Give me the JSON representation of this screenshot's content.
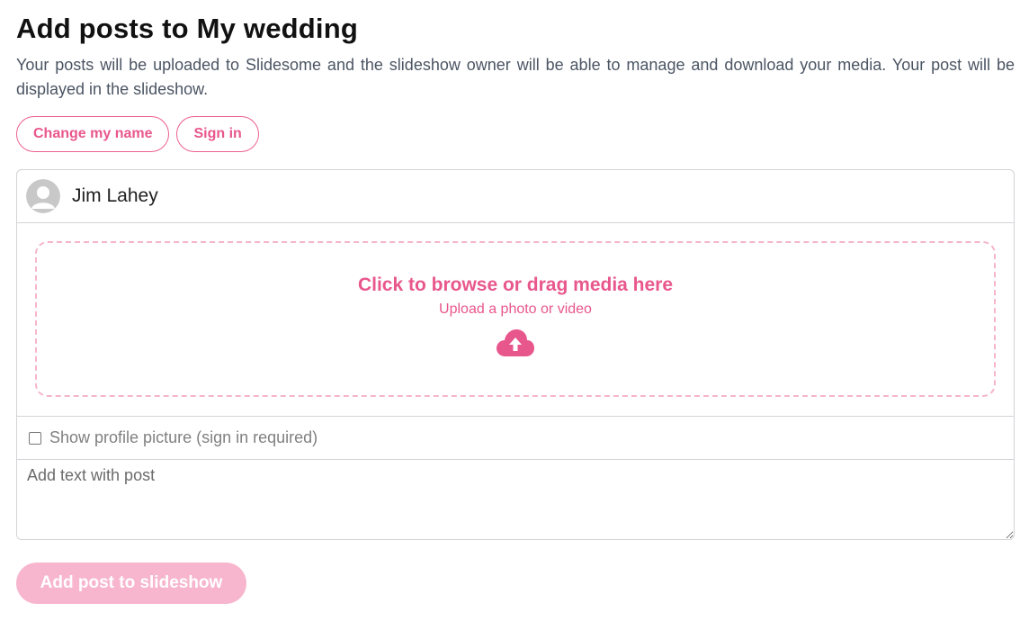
{
  "page": {
    "title": "Add posts to My wedding",
    "intro": "Your posts will be uploaded to Slidesome and the slideshow owner will be able to manage and download your media. Your post will be displayed in the slideshow."
  },
  "actions": {
    "change_name_label": "Change my name",
    "sign_in_label": "Sign in"
  },
  "post_form": {
    "user_name": "Jim Lahey",
    "avatar_icon": "default-user-avatar",
    "upload": {
      "title": "Click to browse or drag media here",
      "subtitle": "Upload a photo or video",
      "icon": "cloud-upload-icon"
    },
    "show_profile_picture": {
      "label": "Show profile picture (sign in required)",
      "checked": false
    },
    "text": {
      "placeholder": "Add text with post",
      "value": ""
    },
    "submit_label": "Add post to slideshow",
    "submit_enabled": false
  },
  "colors": {
    "accent": "#e8578c",
    "accent_light": "#f7b6cd",
    "dashed_border": "#f4b5cb",
    "border": "#d4d4d8",
    "muted_text": "#808080"
  }
}
